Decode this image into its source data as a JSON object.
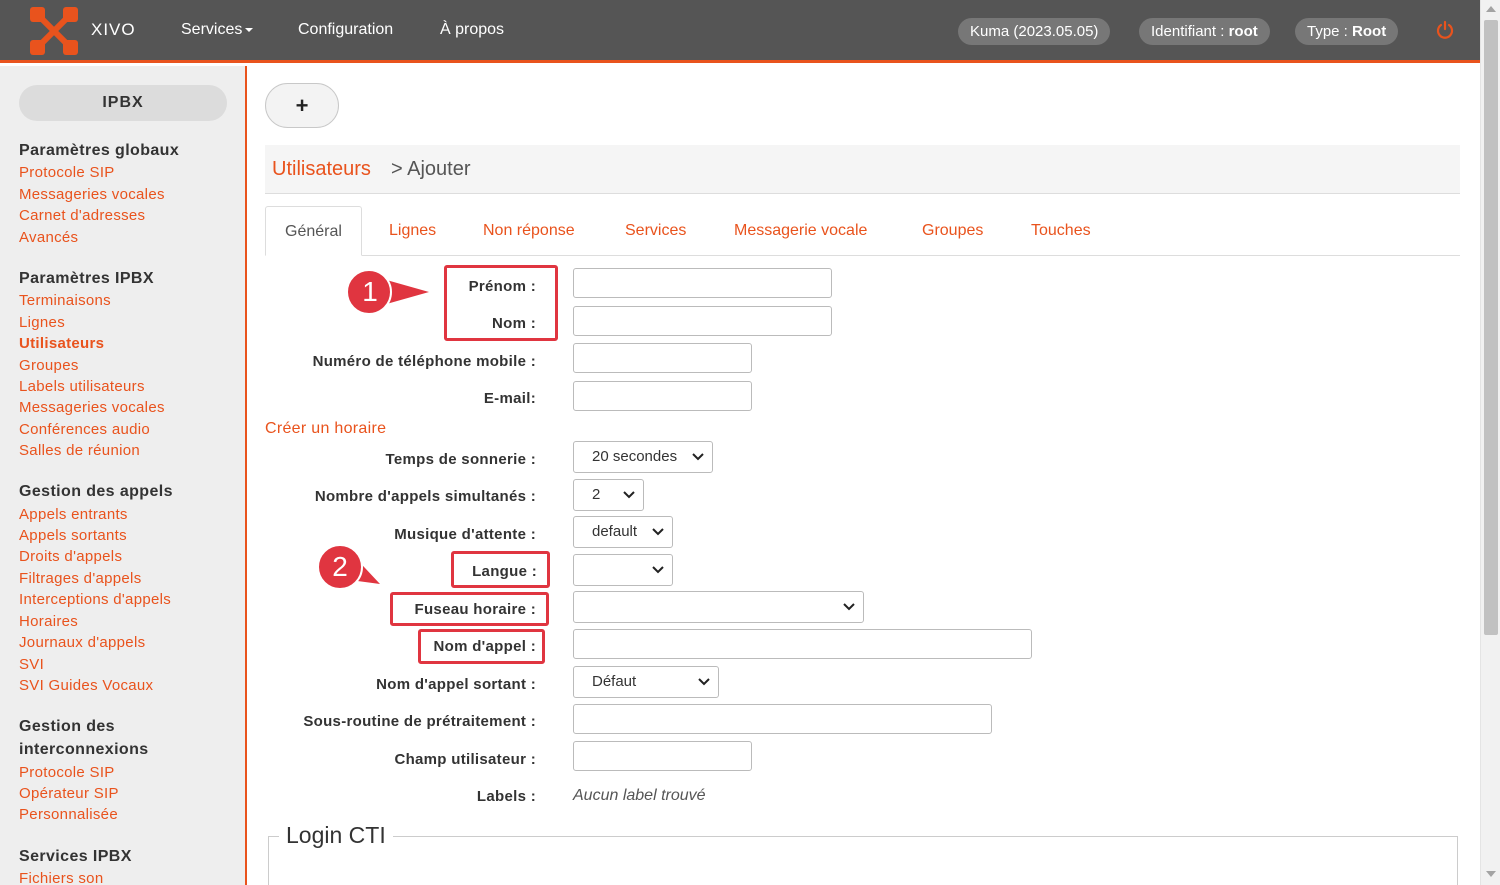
{
  "topbar": {
    "brand": "XIVO",
    "nav": {
      "services": "Services",
      "configuration": "Configuration",
      "apropos": "À propos"
    },
    "version": "Kuma (2023.05.05)",
    "ident_label": "Identifiant : ",
    "ident_value": "root",
    "type_label": "Type : ",
    "type_value": "Root"
  },
  "sidebar": {
    "section": "IPBX",
    "groups": {
      "globaux": {
        "title": "Paramètres globaux",
        "items": [
          "Protocole SIP",
          "Messageries vocales",
          "Carnet d'adresses",
          "Avancés"
        ]
      },
      "ipbx": {
        "title": "Paramètres IPBX",
        "items": [
          "Terminaisons",
          "Lignes",
          "Utilisateurs",
          "Groupes",
          "Labels utilisateurs",
          "Messageries vocales",
          "Conférences audio",
          "Salles de réunion"
        ]
      },
      "appels": {
        "title": "Gestion des appels",
        "items": [
          "Appels entrants",
          "Appels sortants",
          "Droits d'appels",
          "Filtrages d'appels",
          "Interceptions d'appels",
          "Horaires",
          "Journaux d'appels",
          "SVI",
          "SVI Guides Vocaux"
        ]
      },
      "interco": {
        "title": "Gestion des interconnexions",
        "items": [
          "Protocole SIP",
          "Opérateur SIP",
          "Personnalisée"
        ]
      },
      "services": {
        "title": "Services IPBX",
        "items": [
          "Fichiers son"
        ]
      }
    }
  },
  "main": {
    "add_button": "+",
    "breadcrumb": {
      "link": "Utilisateurs",
      "current": "> Ajouter"
    },
    "tabs": [
      "Général",
      "Lignes",
      "Non réponse",
      "Services",
      "Messagerie vocale",
      "Groupes",
      "Touches"
    ],
    "form": {
      "prenom": "Prénom :",
      "nom": "Nom :",
      "mobile": "Numéro de téléphone mobile :",
      "email": "E-mail:",
      "create_schedule": "Créer un horaire",
      "ring_time": "Temps de sonnerie :",
      "ring_time_value": "20 secondes",
      "simult_calls": "Nombre d'appels simultanés :",
      "simult_calls_value": "2",
      "moh": "Musique d'attente :",
      "moh_value": "default",
      "langue": "Langue :",
      "langue_value": "",
      "timezone": "Fuseau horaire :",
      "timezone_value": "",
      "caller_id": "Nom d'appel :",
      "outgoing_cid": "Nom d'appel sortant :",
      "outgoing_cid_value": "Défaut",
      "preprocess": "Sous-routine de prétraitement :",
      "user_field": "Champ utilisateur :",
      "labels": "Labels :",
      "labels_value": "Aucun label trouvé"
    },
    "login_cti": "Login CTI"
  },
  "annotations": {
    "callout1": "1",
    "callout2": "2"
  },
  "colors": {
    "accent": "#e9531d",
    "topbar": "#555555",
    "annotation": "#e03540"
  }
}
